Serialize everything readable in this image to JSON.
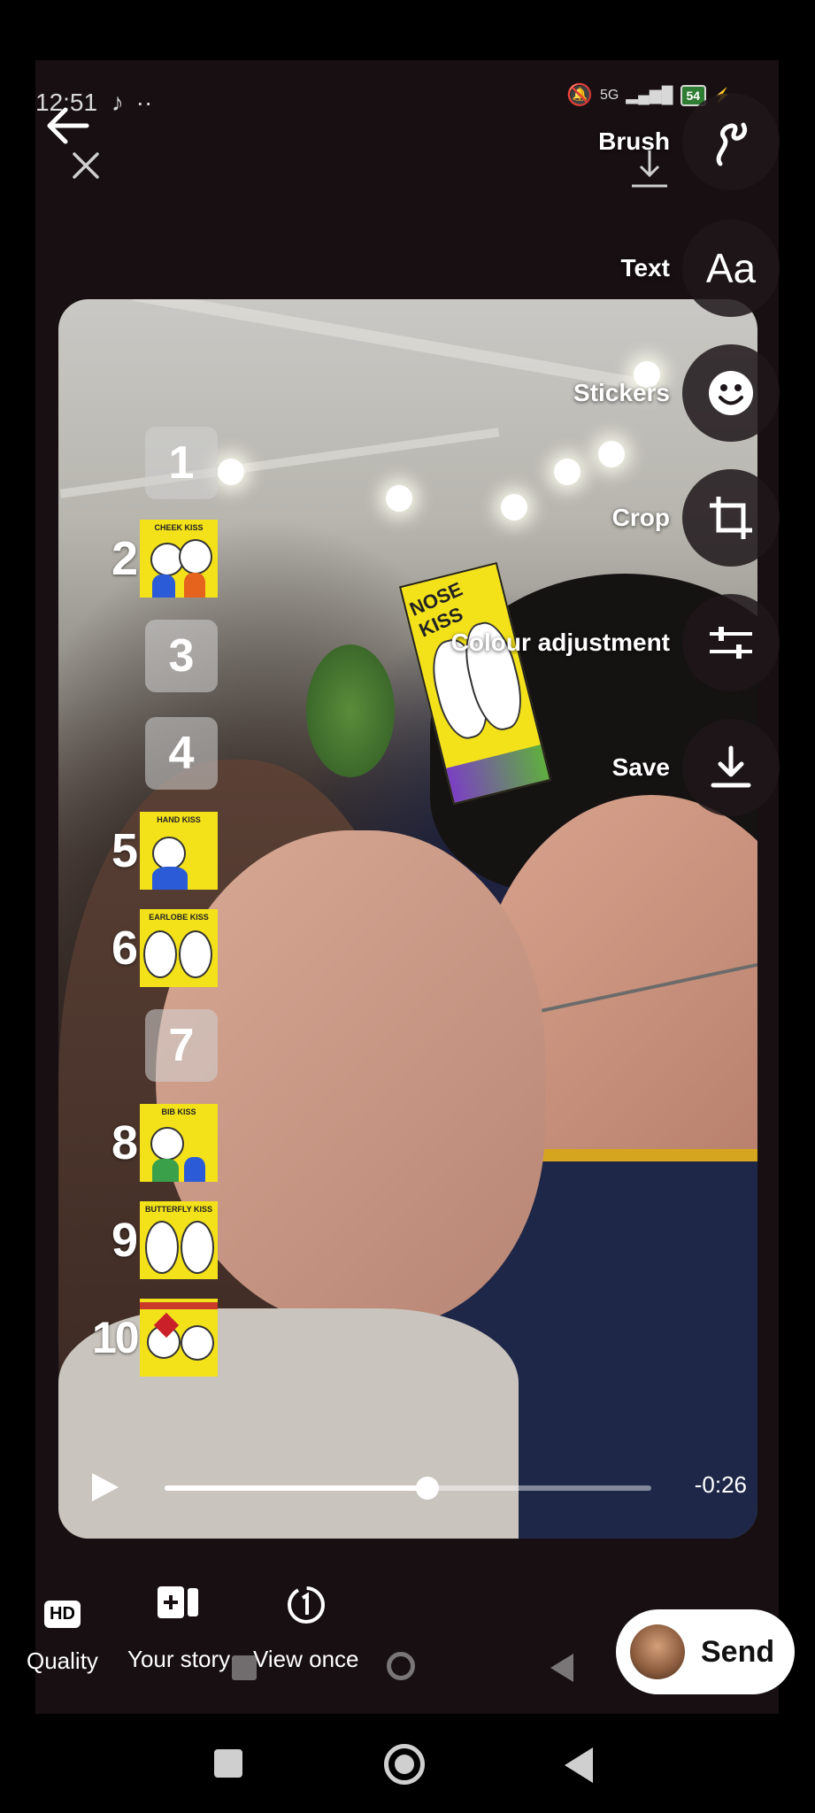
{
  "status_bar": {
    "time": "12:51",
    "dots": "··",
    "network": "5G",
    "battery": "54"
  },
  "toolbar": {
    "items": [
      {
        "label": "Brush",
        "icon": "brush-icon"
      },
      {
        "label": "Text",
        "icon": "text-aa-icon",
        "glyph": "Aa"
      },
      {
        "label": "Stickers",
        "icon": "smiley-sticker-icon"
      },
      {
        "label": "Crop",
        "icon": "crop-icon"
      },
      {
        "label": "Colour adjustment",
        "icon": "sliders-icon"
      },
      {
        "label": "Save",
        "icon": "download-icon"
      }
    ]
  },
  "overlay_list": {
    "numbers": [
      "1",
      "2",
      "3",
      "4",
      "5",
      "6",
      "7",
      "8",
      "9",
      "10"
    ],
    "captions": {
      "2": "CHEEK KISS",
      "5": "HAND KISS",
      "6": "EARLOBE KISS",
      "8": "BIB KISS",
      "9": "BUTTERFLY KISS"
    },
    "sticker_caption": "NOSE KISS"
  },
  "player": {
    "remaining": "-0:26",
    "progress_fraction": 0.54
  },
  "bottom_actions": {
    "quality_label": "Quality",
    "quality_badge": "HD",
    "your_story_label": "Your story",
    "view_once_label": "View once",
    "send_label": "Send"
  }
}
